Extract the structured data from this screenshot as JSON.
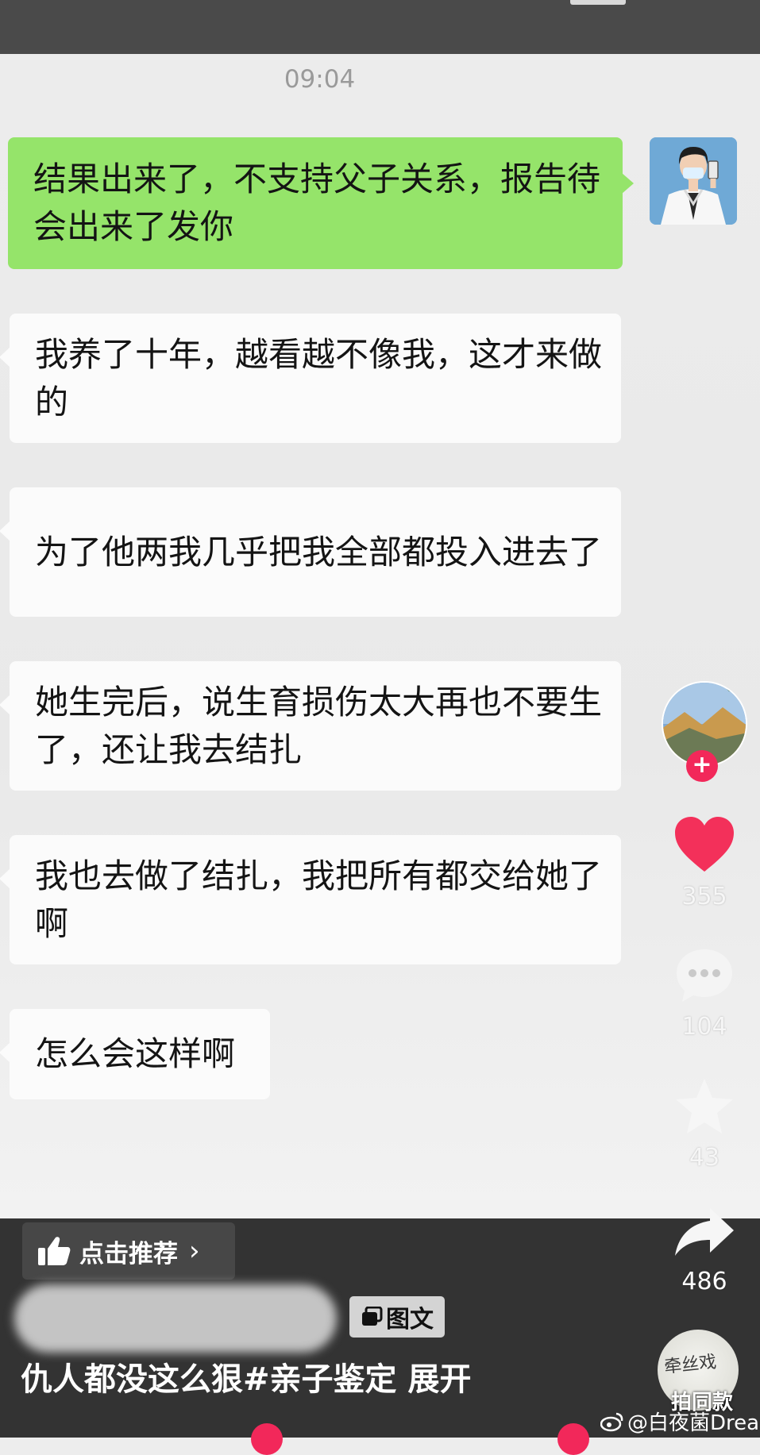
{
  "chat": {
    "timestamp": "09:04",
    "sent_message": "结果出来了，不支持父子关系，报告待会出来了发你",
    "received_messages": [
      "我养了十年，越看越不像我，这才来做的",
      "为了他两我几乎把我全部都投入进去了",
      "她生完后，说生育损伤太大再也不要生了，还让我去结扎",
      "我也去做了结扎，我把所有都交给她了啊",
      "怎么会这样啊"
    ],
    "bubble_colors": {
      "sent": "#95e46a",
      "received": "#fbfbfb"
    }
  },
  "sidebar": {
    "like_count": "355",
    "comment_count": "104",
    "favorite_count": "43",
    "share_count": "486",
    "follow_badge": "+",
    "music_button_label": "拍同款",
    "music_cover_text": "牵丝戏",
    "icons": [
      "creator-avatar-icon",
      "heart-icon",
      "comment-icon",
      "star-icon",
      "share-icon"
    ],
    "accent_color": "#f2285a"
  },
  "bottom_bar": {
    "recommend_label": "点击推荐",
    "recommend_chevron": "›",
    "type_badge": "图文",
    "caption": "仇人都没这么狠#亲子鉴定",
    "expand_label": "展开"
  },
  "watermark": {
    "text": "@白夜菌Dream"
  }
}
